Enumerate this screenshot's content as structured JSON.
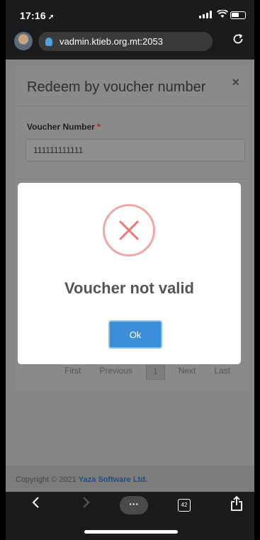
{
  "status_bar": {
    "time": "17:16",
    "location_glyph": "➚"
  },
  "browser": {
    "url": "vadmin.ktieb.org.mt:2053",
    "tab_count": "42"
  },
  "redeem_modal": {
    "title": "Redeem by voucher number",
    "close_glyph": "×",
    "field_label": "Voucher Number",
    "required_mark": "*",
    "field_value": "111111111111"
  },
  "pagination": {
    "first": "First",
    "previous": "Previous",
    "current": "1",
    "next": "Next",
    "last": "Last"
  },
  "footer": {
    "prefix": "Copyright © 2021 ",
    "brand": "Yaza Software Ltd."
  },
  "alert": {
    "message": "Voucher not valid",
    "ok_label": "Ok",
    "icon": "error-x-icon"
  },
  "colors": {
    "ok_button": "#3b8fd9",
    "error_ring": "#f2a5a5",
    "brand_link": "#1f4e82"
  }
}
